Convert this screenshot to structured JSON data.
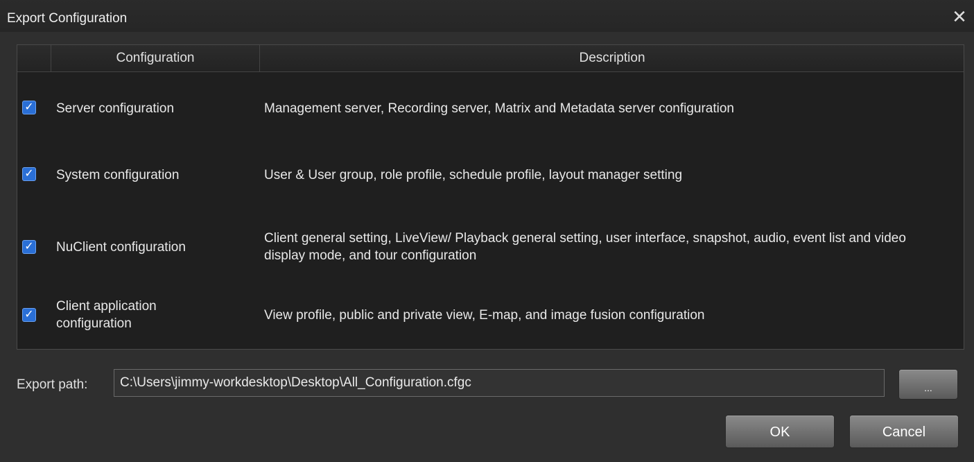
{
  "window": {
    "title": "Export Configuration",
    "close_icon": "close-icon"
  },
  "table": {
    "headers": [
      "",
      "Configuration",
      "Description"
    ],
    "rows": [
      {
        "checked": true,
        "name": "Server configuration",
        "description": "Management server, Recording server, Matrix and Metadata server configuration"
      },
      {
        "checked": true,
        "name": "System configuration",
        "description": "User & User group, role profile, schedule profile, layout manager setting"
      },
      {
        "checked": true,
        "name": "NuClient configuration",
        "description": "Client general setting, LiveView/ Playback general setting, user interface, snapshot, audio, event list and video display mode, and tour configuration"
      },
      {
        "checked": true,
        "name": "Client application configuration",
        "description": "View profile, public and private view, E-map, and image fusion configuration"
      }
    ]
  },
  "export": {
    "label": "Export path:",
    "value": "C:\\Users\\jimmy-workdesktop\\Desktop\\All_Configuration.cfgc",
    "browse_label": "..."
  },
  "buttons": {
    "ok": "OK",
    "cancel": "Cancel"
  },
  "colors": {
    "accent": "#2a6fd6",
    "background": "#2f2f2f",
    "grid": "#1f1f1f"
  }
}
